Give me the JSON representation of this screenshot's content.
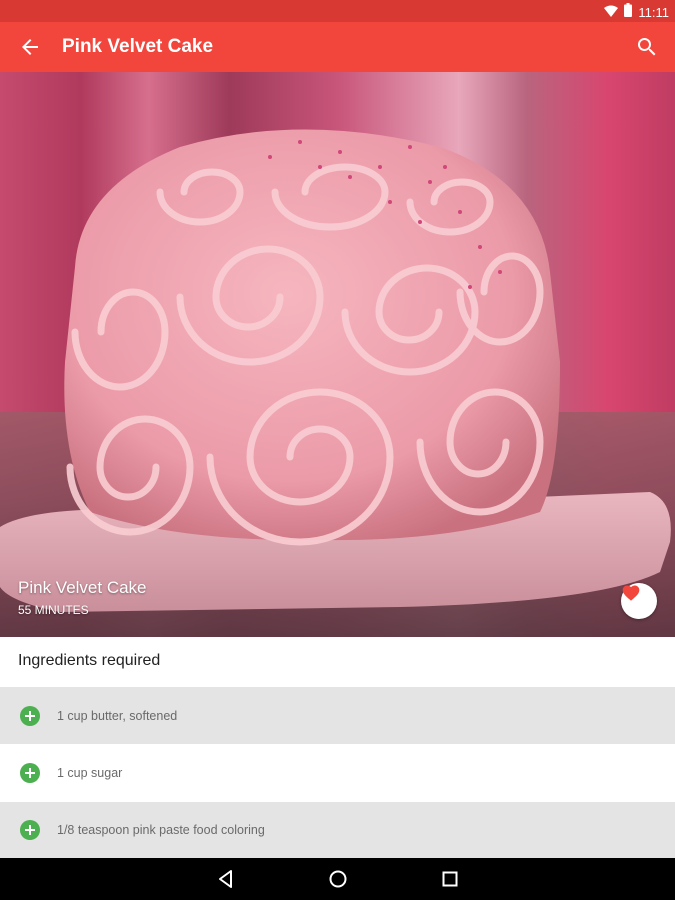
{
  "status_bar": {
    "time": "11:11",
    "icons": [
      "wifi-icon",
      "battery-icon"
    ],
    "background": "#d83a33"
  },
  "app_bar": {
    "title": "Pink Velvet Cake",
    "background": "#f2453b",
    "icons": [
      "back-arrow-icon",
      "search-icon"
    ]
  },
  "hero": {
    "image_subject": "pink rose-frosted cake",
    "title": "Pink Velvet Cake",
    "duration": "55 MINUTES",
    "favorite_icon": "heart-icon",
    "favorite_color": "#f2453b"
  },
  "ingredients": {
    "header": "Ingredients required",
    "items": [
      {
        "text": "1 cup butter, softened"
      },
      {
        "text": "1 cup sugar"
      },
      {
        "text": "1/8 teaspoon pink paste food coloring"
      }
    ],
    "add_icon": "add-circle-icon",
    "add_color": "#4caf50"
  },
  "nav_bar": {
    "buttons": [
      "back-triangle-icon",
      "home-circle-icon",
      "recents-square-icon"
    ]
  }
}
